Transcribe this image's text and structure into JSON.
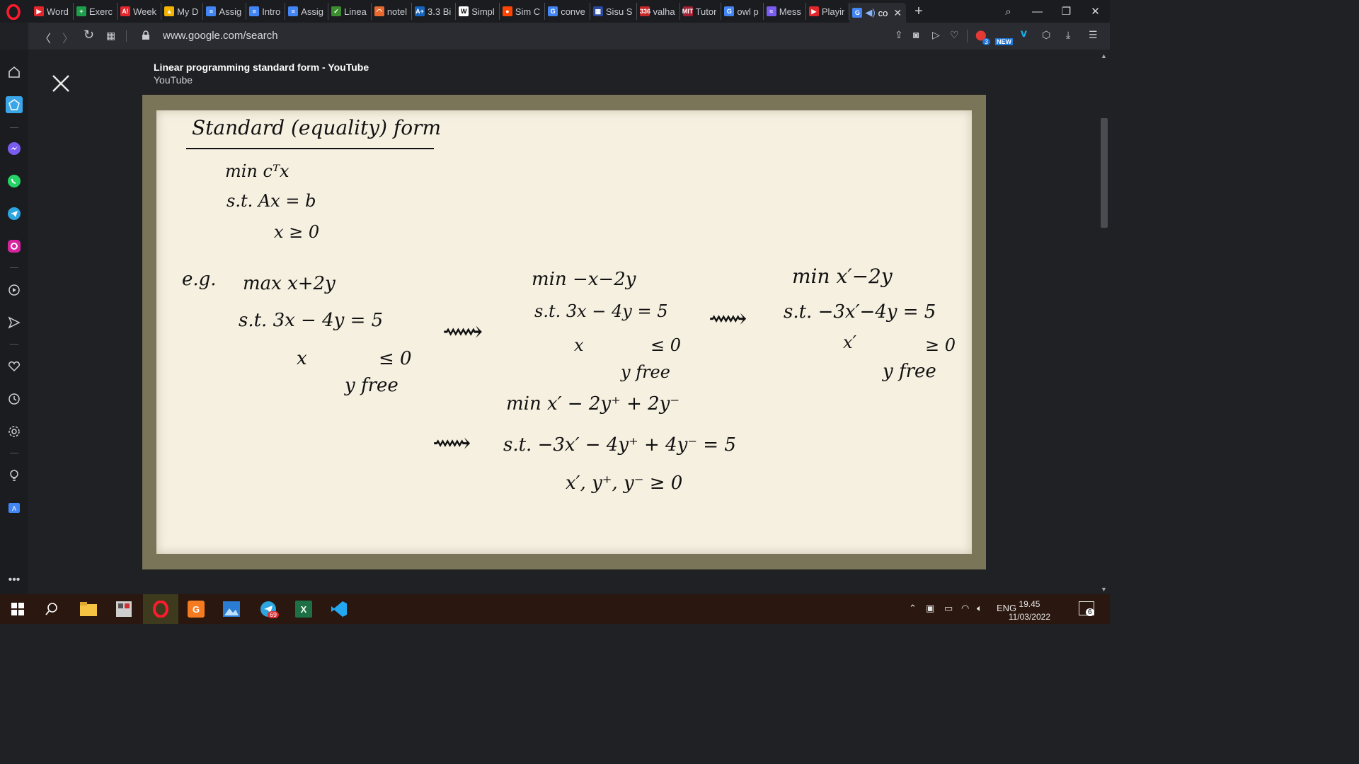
{
  "browser": {
    "tabs": [
      {
        "label": "Word",
        "color": "#e3262b",
        "glyph": "▶"
      },
      {
        "label": "Exerc",
        "color": "#1e9e4a",
        "glyph": "+"
      },
      {
        "label": "Week",
        "color": "#e3262b",
        "glyph": "A!"
      },
      {
        "label": "My D",
        "color": "#f4b400",
        "glyph": "▲"
      },
      {
        "label": "Assig",
        "color": "#4285f4",
        "glyph": "≡"
      },
      {
        "label": "Intro",
        "color": "#4285f4",
        "glyph": "≡"
      },
      {
        "label": "Assig",
        "color": "#4285f4",
        "glyph": "≡"
      },
      {
        "label": "Linea",
        "color": "#3c8d2f",
        "glyph": "✓"
      },
      {
        "label": "notel",
        "color": "#e86a2e",
        "glyph": "◠"
      },
      {
        "label": "3.3 Bi",
        "color": "#1565c0",
        "glyph": "A+"
      },
      {
        "label": "Simpl",
        "color": "#ffffff",
        "glyph": "W"
      },
      {
        "label": "Sim C",
        "color": "#ff4500",
        "glyph": "●"
      },
      {
        "label": "conve",
        "color": "#4285f4",
        "glyph": "G"
      },
      {
        "label": "Sisu S",
        "color": "#2a4aa0",
        "glyph": "▦"
      },
      {
        "label": "valha",
        "color": "#c62828",
        "glyph": "336"
      },
      {
        "label": "Tutor",
        "color": "#a31f34",
        "glyph": "MIT"
      },
      {
        "label": "owl p",
        "color": "#4285f4",
        "glyph": "G"
      },
      {
        "label": "Mess",
        "color": "#7b5cf0",
        "glyph": "≈"
      },
      {
        "label": "Playir",
        "color": "#e3262b",
        "glyph": "▶"
      }
    ],
    "active_tab": {
      "label": "co",
      "glyph": "G"
    },
    "url": "www.google.com/search"
  },
  "viewer": {
    "title": "Linear programming standard form - YouTube",
    "source": "YouTube"
  },
  "whiteboard": {
    "heading": "Standard (equality) form",
    "std_line1": "min cᵀx",
    "std_line2": "s.t. Ax = b",
    "std_line3": "x ≥ 0",
    "eg_label": "e.g.",
    "ex1_line1": "max x+2y",
    "ex1_line2": "s.t. 3x − 4y = 5",
    "ex1_line3a": "x",
    "ex1_line3b": "≤ 0",
    "ex1_line4": "y free",
    "arrow1": "⟿",
    "ex2_line1": "min −x−2y",
    "ex2_line2": "s.t. 3x − 4y = 5",
    "ex2_line3a": "x",
    "ex2_line3b": "≤ 0",
    "ex2_line4": "y free",
    "arrow2": "⟿",
    "ex3_line1": "min x′−2y",
    "ex3_line2": "s.t. −3x′−4y = 5",
    "ex3_line3a": "x′",
    "ex3_line3b": "≥ 0",
    "ex3_line4": "y free",
    "arrow3": "⟿",
    "ex4_line1": "min x′ − 2y⁺ + 2y⁻",
    "ex4_line2": "s.t. −3x′ − 4y⁺ + 4y⁻ = 5",
    "ex4_line3": "x′, y⁺, y⁻ ≥ 0"
  },
  "taskbar": {
    "lang": "ENG",
    "time": "19.45",
    "date": "11/03/2022",
    "telegram_badge": "69",
    "notif_count": "6"
  },
  "sidebar": {
    "extensions_badge": "3",
    "new_badge": "NEW"
  }
}
